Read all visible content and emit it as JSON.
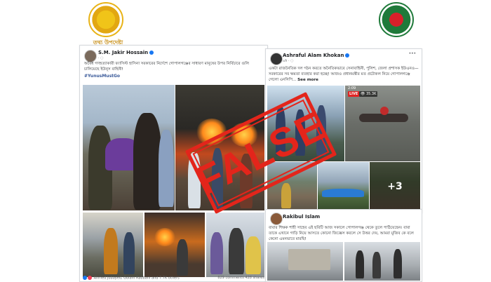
{
  "logos": {
    "left_caption": "তথ্য উপদেষ্টা"
  },
  "post1": {
    "author": "S.M. Jakir Hossain",
    "text": "অবৈধ গণহত্যাকারী ফ্যাসিস্ট হাসিনা সরকারের নির্দেশে গোপালগঞ্জের সাধারণ মানুষের উপর নির্বিচারে গুলি চালিয়েছে ইউনূস বাহিনী!",
    "hashtag": "#YunusMustGo",
    "reactions_text": "Ahmed Jubayed, Golam Rabbani and 7.7K others",
    "counts_text": "829 comments  428 shares"
  },
  "post2": {
    "author": "Ashraful Alam Khokan",
    "text": "একটা রাজনৈতিক দল গঠন করতে অনৈতিকভাবে সেনাবাহিনী, পুলিশ, জেলা প্রশাসক ইউএনও—সরকারের সব ক্ষমতা ব্যবহার করা হচ্ছে! আজও প্রধানমন্ত্রীর মত প্রটোকল নিয়ে গোপালগঞ্জে গেলো এনসিপি...",
    "see_more": "See more",
    "video_time": "2:09",
    "live_label": "LIVE",
    "viewer_count": "35.3K",
    "more_photos": "+3"
  },
  "post3": {
    "author": "Rakibul Islam",
    "text": "বাবার শিক্ষক শাহী সাহেব এই ছবিটি আজ সকালে গোপালগঞ্জ থেকে তুলে পাঠিয়েছেন। বাবা তাকে এখানে গাড়ি নিয়ে আসতে কোনো জিজ্ঞেস করলে সে উত্তর দেয়, আমরা মুজিব কে বলে কেনো এমনভাবে মারছি!"
  },
  "stamp": {
    "word": "FALSE",
    "color": "#e3251b"
  }
}
